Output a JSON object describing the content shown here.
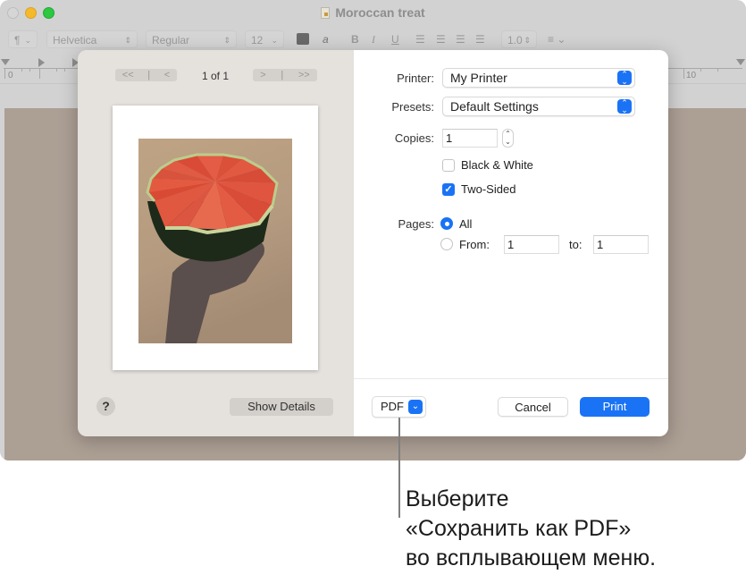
{
  "window": {
    "title": "Moroccan treat",
    "traffic_lights": [
      "close",
      "minimize",
      "zoom"
    ]
  },
  "toolbar": {
    "paragraph_style": "¶",
    "font_family": "Helvetica",
    "font_style": "Regular",
    "font_size": "12",
    "text_color": "#6a6a6a",
    "highlight_icon": "a",
    "bold": "B",
    "italic": "I",
    "underline": "U",
    "alignments": [
      "align-left",
      "align-center",
      "align-right",
      "justify"
    ],
    "line_spacing": "1.0",
    "list_icon": "list-icon"
  },
  "ruler": {
    "labels": [
      "0",
      "10"
    ]
  },
  "print_dialog": {
    "preview": {
      "first_page": "<<",
      "prev_page": "<",
      "next_page": ">",
      "last_page": ">>",
      "page_indicator": "1 of 1"
    },
    "help_label": "?",
    "show_details_label": "Show Details",
    "printer": {
      "label": "Printer:",
      "value": "My Printer"
    },
    "presets": {
      "label": "Presets:",
      "value": "Default Settings"
    },
    "copies": {
      "label": "Copies:",
      "value": "1"
    },
    "black_white": {
      "label": "Black & White",
      "checked": false
    },
    "two_sided": {
      "label": "Two-Sided",
      "checked": true
    },
    "pages": {
      "label": "Pages:",
      "all_label": "All",
      "all_selected": true,
      "from_label": "From:",
      "from_value": "1",
      "to_label": "to:",
      "to_value": "1"
    },
    "pdf_label": "PDF",
    "cancel_label": "Cancel",
    "print_label": "Print",
    "accent_color": "#1a73f5"
  },
  "callout": {
    "line1": "Выберите",
    "line2": "«Сохранить как PDF»",
    "line3": "во всплывающем меню."
  }
}
